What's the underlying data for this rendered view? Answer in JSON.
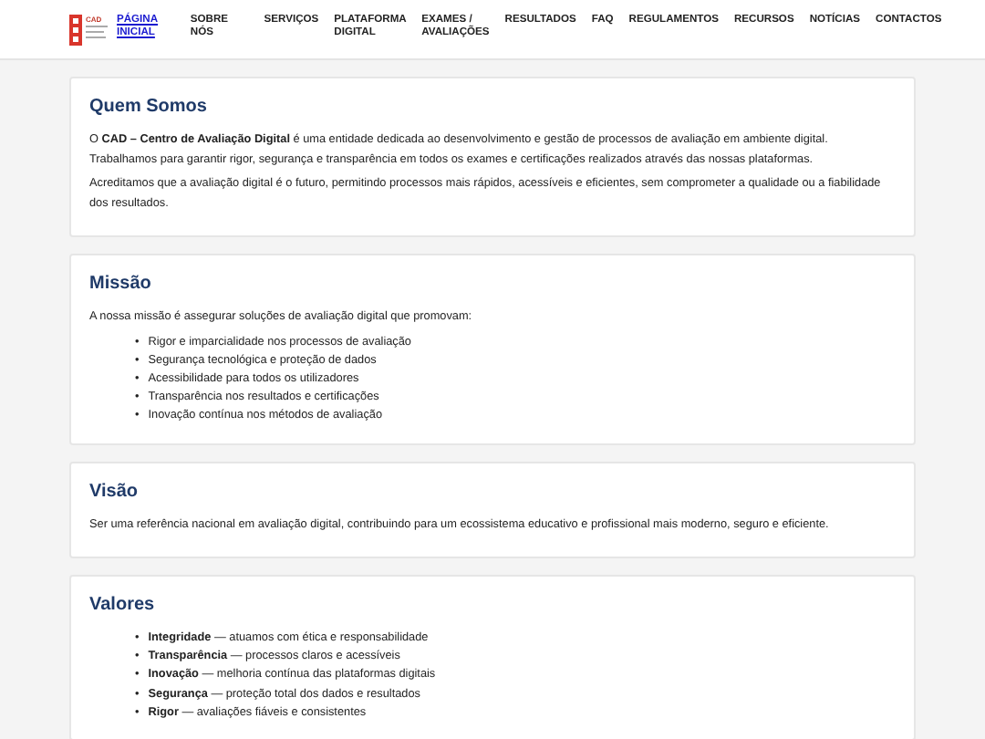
{
  "header": {
    "logo": {
      "text": "CAD"
    },
    "nav": [
      {
        "label": "PÁGINA INICIAL",
        "selected": true
      },
      {
        "label": "SOBRE NÓS",
        "selected": false
      },
      {
        "label": "SERVIÇOS",
        "selected": false
      },
      {
        "label": "PLATAFORMA DIGITAL",
        "selected": false
      },
      {
        "label": "EXAMES / AVALIAÇÕES",
        "selected": false
      },
      {
        "label": "RESULTADOS",
        "selected": false
      },
      {
        "label": "FAQ",
        "selected": false
      },
      {
        "label": "REGULAMENTOS",
        "selected": false
      },
      {
        "label": "RECURSOS",
        "selected": false
      },
      {
        "label": "NOTÍCIAS",
        "selected": false
      },
      {
        "label": "CONTACTOS",
        "selected": false
      }
    ]
  },
  "sections": [
    {
      "title": "Quem Somos",
      "paragraphs": [
        "O **CAD – Centro de Avaliação Digital** é uma entidade dedicada ao desenvolvimento e gestão de processos de avaliação em ambiente digital. Trabalhamos para garantir rigor, segurança e transparência em todos os exames e certificações realizados através das nossas plataformas.",
        "Acreditamos que a avaliação digital é o futuro, permitindo processos mais rápidos, acessíveis e eficientes, sem comprometer a qualidade ou a fiabilidade dos resultados."
      ]
    },
    {
      "title": "Missão",
      "paragraphs": [
        "A nossa missão é assegurar soluções de avaliação digital que promovam:"
      ],
      "list": [
        {
          "bullet": "•",
          "text": "Rigor e imparcialidade nos processos de avaliação"
        },
        {
          "bullet": "•",
          "text": "Segurança tecnológica e proteção de dados"
        },
        {
          "bullet": "•",
          "text": "Acessibilidade para todos os utilizadores"
        },
        {
          "bullet": "•",
          "text": "Transparência nos resultados e certificações"
        },
        {
          "bullet": "•",
          "text": "Inovação contínua nos métodos de avaliação"
        }
      ]
    },
    {
      "title": "Visão",
      "paragraphs": [
        "Ser uma referência nacional em avaliação digital, contribuindo para um ecossistema educativo e profissional mais moderno, seguro e eficiente."
      ]
    },
    {
      "title": "Valores",
      "list": [
        {
          "bullet": "•",
          "text": "**Integridade** — atuamos com ética e responsabilidade"
        },
        {
          "bullet": "•",
          "text": "**Transparência** — processos claros e acessíveis"
        },
        {
          "bullet": "•",
          "text": "**Inovação** — melhoria contínua das plataformas digitais"
        },
        {
          "bullet": "•",
          "text": "**Segurança** — proteção total dos dados e resultados"
        },
        {
          "bullet": "•",
          "text": "**Rigor** — avaliações fiáveis e consistentes"
        }
      ]
    }
  ]
}
